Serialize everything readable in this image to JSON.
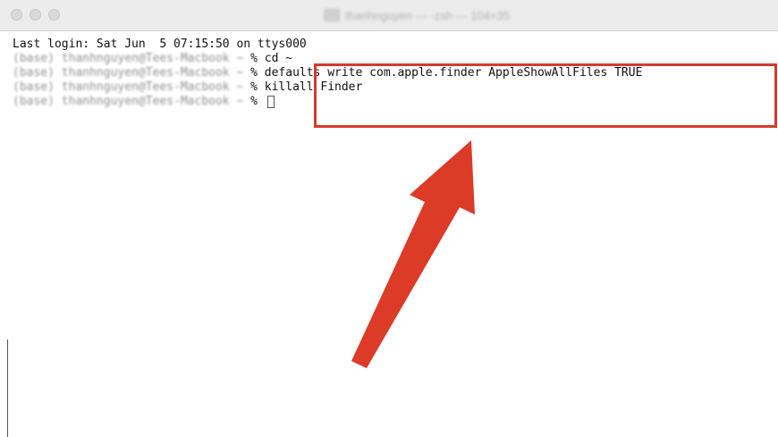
{
  "window": {
    "title": "thanhnguyen — -zsh — 104×35"
  },
  "terminal": {
    "last_login": "Last login: Sat Jun  5 07:15:50 on ttys000",
    "prompt": "(base) thanhnguyen@Tees-Macbook ~ ",
    "prompt_symbol": "% ",
    "lines": [
      {
        "command": "cd ~"
      },
      {
        "command": "defaults write com.apple.finder AppleShowAllFiles TRUE"
      },
      {
        "command": "killall Finder"
      },
      {
        "command": ""
      }
    ]
  },
  "annotation": {
    "highlight_color": "#d63a2b",
    "arrow_color": "#dc3b28"
  }
}
